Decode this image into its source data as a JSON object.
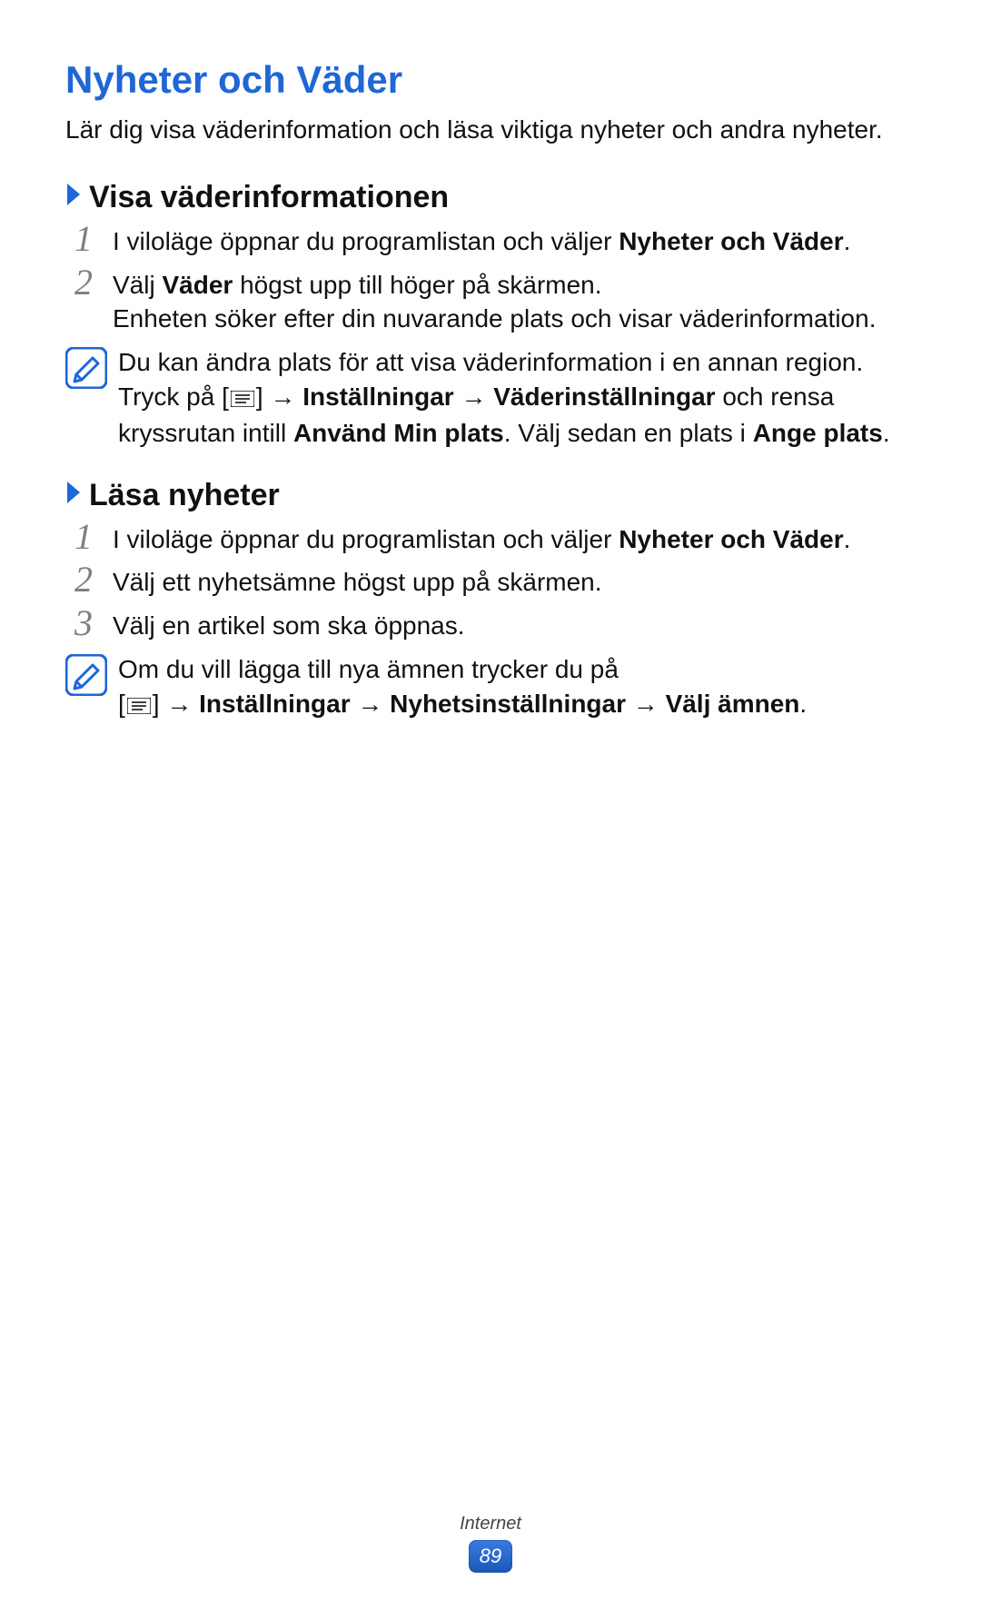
{
  "title": "Nyheter och Väder",
  "intro": "Lär dig visa väderinformation och läsa viktiga nyheter och andra nyheter.",
  "section1": {
    "heading": "Visa väderinformationen",
    "steps": {
      "s1_pre": "I viloläge öppnar du programlistan och väljer ",
      "s1_bold": "Nyheter och Väder",
      "s1_post": ".",
      "s2_pre": "Välj ",
      "s2_bold": "Väder",
      "s2_post": " högst upp till höger på skärmen.",
      "s2_extra": "Enheten söker efter din nuvarande plats och visar väderinformation."
    },
    "note": {
      "p1": "Du kan ändra plats för att visa väderinformation i en annan region. Tryck på [",
      "p2": "] → ",
      "b1": "Inställningar",
      "p3": " → ",
      "b2": "Väderinställningar",
      "p4": " och rensa kryssrutan intill ",
      "b3": "Använd Min plats",
      "p5": ". Välj sedan en plats i ",
      "b4": "Ange plats",
      "p6": "."
    }
  },
  "section2": {
    "heading": "Läsa nyheter",
    "steps": {
      "s1_pre": "I viloläge öppnar du programlistan och väljer ",
      "s1_bold": "Nyheter och Väder",
      "s1_post": ".",
      "s2": "Välj ett nyhetsämne högst upp på skärmen.",
      "s3": "Välj en artikel som ska öppnas."
    },
    "note": {
      "p1": "Om du vill lägga till nya ämnen trycker du på",
      "p2": "[",
      "p3": "] → ",
      "b1": "Inställningar",
      "p4": " → ",
      "b2": "Nyhetsinställningar",
      "p5": " → ",
      "b3": "Välj ämnen",
      "p6": "."
    }
  },
  "footer": {
    "category": "Internet",
    "page": "89"
  }
}
